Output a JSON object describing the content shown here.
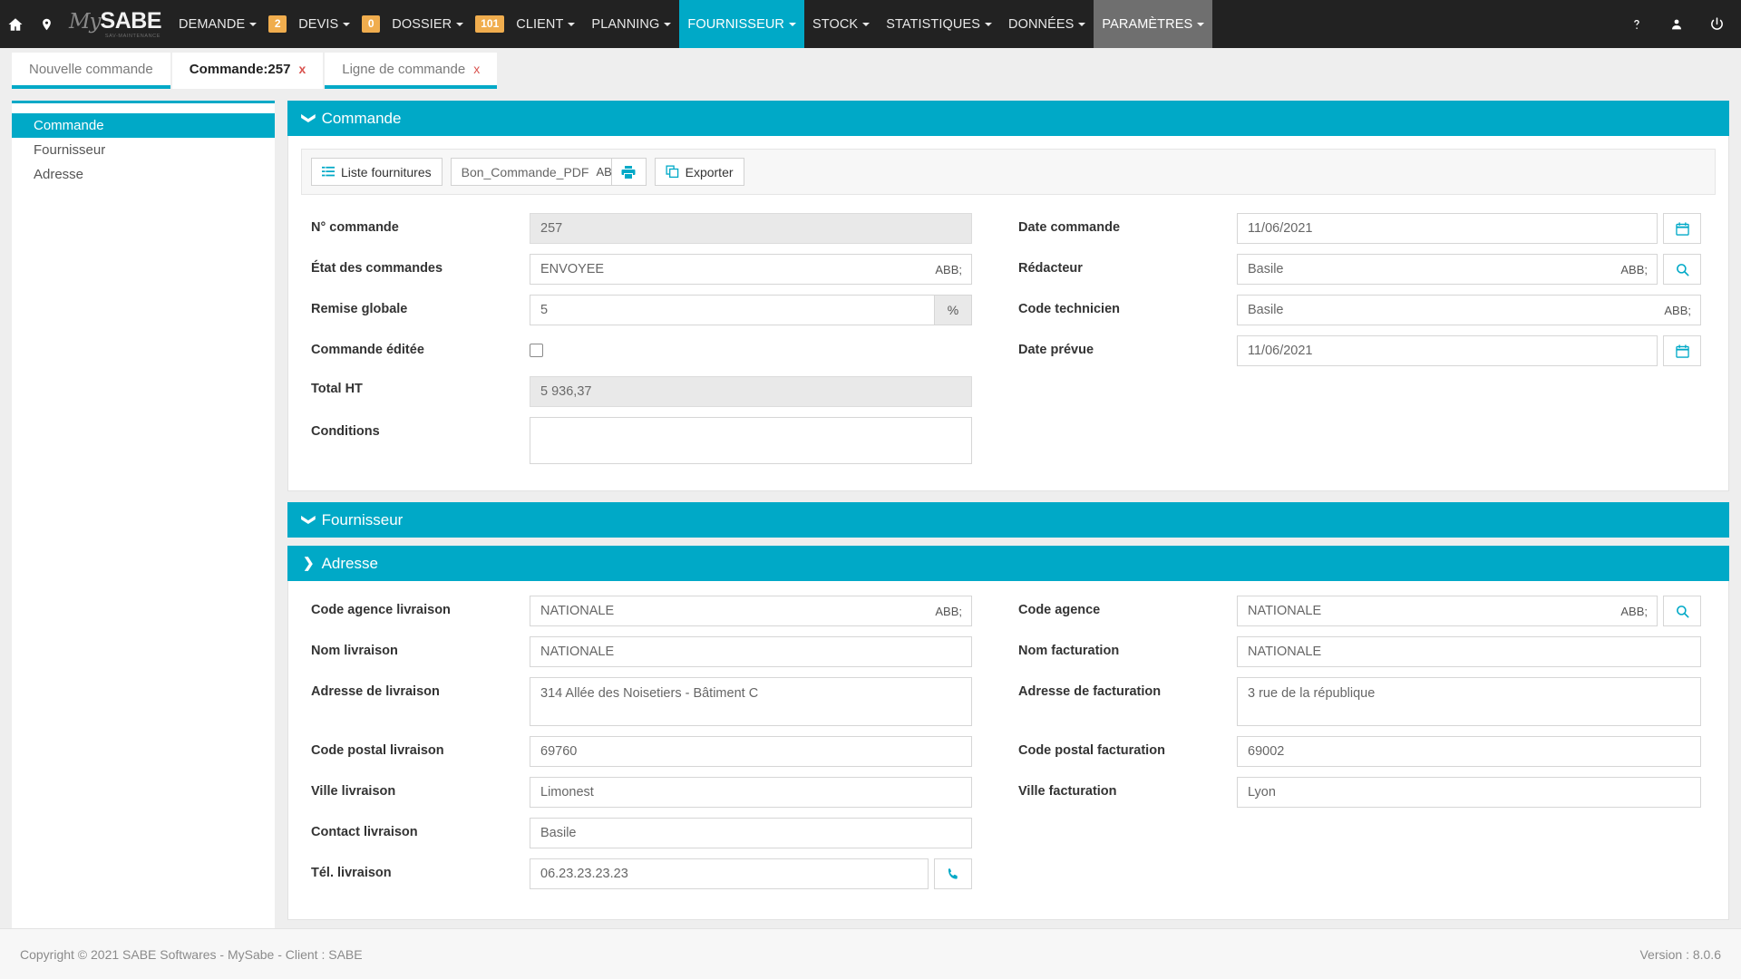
{
  "colors": {
    "accent": "#00a9c7",
    "navbar_bg": "#222222",
    "badge": "#f0ad4e",
    "tab_close": "#d9534f",
    "page_bg": "#eeeeee"
  },
  "navbar": {
    "brand": {
      "prefix": "My",
      "name": "SABE",
      "subtitle": "SAV-MAINTENANCE"
    },
    "left_icons": [
      {
        "name": "home-icon",
        "label": "Accueil"
      },
      {
        "name": "map-marker-icon",
        "label": "Localisation"
      }
    ],
    "items": [
      {
        "label": "DEMANDE",
        "caret": true,
        "badge": "2",
        "state": ""
      },
      {
        "label": "DEVIS",
        "caret": true,
        "badge": "0",
        "state": ""
      },
      {
        "label": "DOSSIER",
        "caret": true,
        "badge": "101",
        "state": ""
      },
      {
        "label": "CLIENT",
        "caret": true,
        "badge": null,
        "state": ""
      },
      {
        "label": "PLANNING",
        "caret": true,
        "badge": null,
        "state": ""
      },
      {
        "label": "FOURNISSEUR",
        "caret": true,
        "badge": null,
        "state": "active-teal"
      },
      {
        "label": "STOCK",
        "caret": true,
        "badge": null,
        "state": ""
      },
      {
        "label": "STATISTIQUES",
        "caret": true,
        "badge": null,
        "state": ""
      },
      {
        "label": "DONNÉES",
        "caret": true,
        "badge": null,
        "state": ""
      },
      {
        "label": "PARAMÈTRES",
        "caret": true,
        "badge": null,
        "state": "active-grey"
      }
    ],
    "right_icons": [
      {
        "name": "help-icon",
        "label": "Aide"
      },
      {
        "name": "user-icon",
        "label": "Utilisateur"
      },
      {
        "name": "power-icon",
        "label": "Déconnexion"
      }
    ]
  },
  "tabs": [
    {
      "label": "Nouvelle commande",
      "active": false,
      "underlined": true,
      "closable": false,
      "close": ""
    },
    {
      "label": "Commande:257",
      "active": true,
      "underlined": false,
      "closable": true,
      "close": "x"
    },
    {
      "label": "Ligne de commande",
      "active": false,
      "underlined": true,
      "closable": true,
      "close": "x"
    }
  ],
  "sidebar": {
    "items": [
      {
        "label": "Commande",
        "active": true
      },
      {
        "label": "Fournisseur",
        "active": false
      },
      {
        "label": "Adresse",
        "active": false
      }
    ]
  },
  "panels": {
    "commande": {
      "title": "Commande",
      "chevron": "❯",
      "expanded": true
    },
    "fournisseur": {
      "title": "Fournisseur",
      "chevron": "❯",
      "expanded": true
    },
    "adresse": {
      "title": "Adresse",
      "chevron": "❯",
      "expanded": false
    }
  },
  "toolbar": {
    "liste_fournitures_label": "Liste fournitures",
    "document_select_value": "Bon_Commande_PDF",
    "print_title": "Imprimer",
    "exporter_label": "Exporter"
  },
  "commande_form": {
    "left": {
      "num_commande_label": "N° commande",
      "num_commande_value": "257",
      "etat_label": "État des commandes",
      "etat_value": "ENVOYEE",
      "remise_label": "Remise globale",
      "remise_value": "5",
      "remise_unit": "%",
      "editee_label": "Commande éditée",
      "editee_checked": false,
      "total_ht_label": "Total HT",
      "total_ht_value": "5 936,37",
      "conditions_label": "Conditions",
      "conditions_value": ""
    },
    "right": {
      "date_commande_label": "Date commande",
      "date_commande_value": "11/06/2021",
      "redacteur_label": "Rédacteur",
      "redacteur_value": "Basile",
      "code_technicien_label": "Code technicien",
      "code_technicien_value": "Basile",
      "date_prevue_label": "Date prévue",
      "date_prevue_value": "11/06/2021"
    }
  },
  "adresse_form": {
    "left": {
      "code_agence_livraison_label": "Code agence livraison",
      "code_agence_livraison_value": "NATIONALE",
      "nom_livraison_label": "Nom livraison",
      "nom_livraison_value": "NATIONALE",
      "adresse_livraison_label": "Adresse de livraison",
      "adresse_livraison_value": "314 Allée des Noisetiers - Bâtiment C",
      "cp_livraison_label": "Code postal livraison",
      "cp_livraison_value": "69760",
      "ville_livraison_label": "Ville livraison",
      "ville_livraison_value": "Limonest",
      "contact_livraison_label": "Contact livraison",
      "contact_livraison_value": "Basile",
      "tel_livraison_label": "Tél. livraison",
      "tel_livraison_value": "06.23.23.23.23"
    },
    "right": {
      "code_agence_label": "Code agence",
      "code_agence_value": "NATIONALE",
      "nom_facturation_label": "Nom facturation",
      "nom_facturation_value": "NATIONALE",
      "adresse_facturation_label": "Adresse de facturation",
      "adresse_facturation_value": "3 rue de la république",
      "cp_facturation_label": "Code postal facturation",
      "cp_facturation_value": "69002",
      "ville_facturation_label": "Ville facturation",
      "ville_facturation_value": "Lyon"
    }
  },
  "footer": {
    "copyright": "Copyright © 2021 SABE Softwares - MySabe - Client : SABE",
    "version": "Version : 8.0.6"
  }
}
